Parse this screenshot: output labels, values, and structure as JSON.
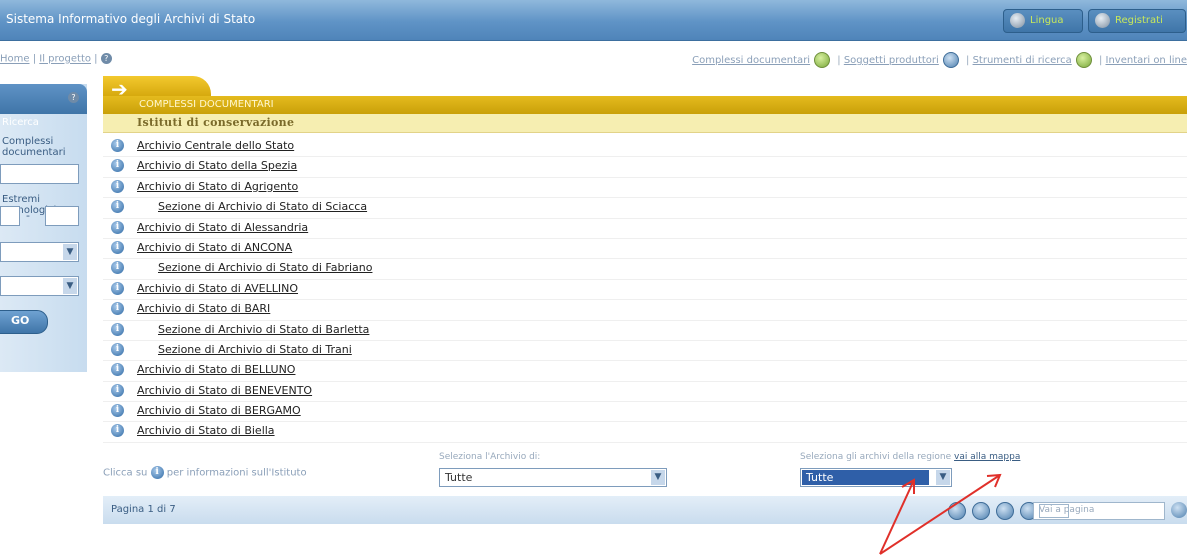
{
  "header": {
    "title": "Sistema Informativo degli Archivi di Stato",
    "pill1_label": "Lingua",
    "pill2_label": "Registrati"
  },
  "navbar": {
    "left_link1": "Home",
    "left_link2": "Il progetto",
    "right_links": [
      "Complessi documentari",
      "Soggetti produttori",
      "Strumenti di ricerca",
      "Inventari on line"
    ]
  },
  "sidebar": {
    "title": "Ricerca",
    "label1": "Complessi documentari",
    "label2": "Estremi cronologici:",
    "range_sep": "-",
    "go_label": "GO"
  },
  "content": {
    "section_label": "COMPLESSI DOCUMENTARI",
    "subheader": "Istituti di conservazione",
    "rows": [
      {
        "name": "Archivio Centrale dello Stato",
        "sub": false
      },
      {
        "name": "Archivio di Stato della Spezia",
        "sub": false
      },
      {
        "name": "Archivio di Stato di Agrigento",
        "sub": false
      },
      {
        "name": "Sezione di Archivio di Stato di Sciacca",
        "sub": true
      },
      {
        "name": "Archivio di Stato di Alessandria",
        "sub": false
      },
      {
        "name": "Archivio di Stato di ANCONA",
        "sub": false
      },
      {
        "name": "Sezione di Archivio di Stato di Fabriano",
        "sub": true
      },
      {
        "name": "Archivio di Stato di AVELLINO",
        "sub": false
      },
      {
        "name": "Archivio di Stato di BARI",
        "sub": false
      },
      {
        "name": "Sezione di Archivio di Stato di Barletta",
        "sub": true
      },
      {
        "name": "Sezione di Archivio di Stato di Trani",
        "sub": true
      },
      {
        "name": "Archivio di Stato di BELLUNO",
        "sub": false
      },
      {
        "name": "Archivio di Stato di BENEVENTO",
        "sub": false
      },
      {
        "name": "Archivio di Stato di BERGAMO",
        "sub": false
      },
      {
        "name": "Archivio di Stato di Biella",
        "sub": false
      }
    ]
  },
  "footer": {
    "note_before": "Clicca su",
    "note_after": "per informazioni sull'Istituto",
    "select_archivio_label": "Seleziona l'Archivio di:",
    "select_archivio_value": "Tutte",
    "select_regione_label": "Seleziona gli archivi della regione",
    "select_regione_link": "vai alla mappa",
    "select_regione_value": "Tutte"
  },
  "pager": {
    "page_text": "Pagina 1 di 7",
    "goto_label": "Vai a pagina"
  },
  "colors": {
    "header_blue": "#5f93c6",
    "gold": "#d6a90e",
    "subheader_bg": "#f6eeb1",
    "annotation_arrow": "#e0302a"
  }
}
